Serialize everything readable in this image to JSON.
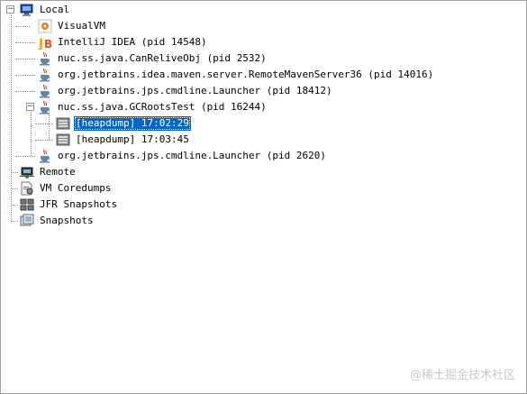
{
  "tree": {
    "local": {
      "label": "Local",
      "toggle": "−"
    },
    "visualvm": {
      "label": "VisualVM"
    },
    "intellij": {
      "label": "IntelliJ IDEA (pid 14548)"
    },
    "canrelive": {
      "label": "nuc.ss.java.CanReliveObj (pid 2532)"
    },
    "maven": {
      "label": "org.jetbrains.idea.maven.server.RemoteMavenServer36 (pid 14016)"
    },
    "launcher1": {
      "label": "org.jetbrains.jps.cmdline.Launcher (pid 18412)"
    },
    "gcroots": {
      "label": "nuc.ss.java.GCRootsTest (pid 16244)",
      "toggle": "−"
    },
    "heapdump1": {
      "label": "[heapdump] 17:02:29"
    },
    "heapdump2": {
      "label": "[heapdump] 17:03:45"
    },
    "launcher2": {
      "label": "org.jetbrains.jps.cmdline.Launcher (pid 2620)"
    },
    "remote": {
      "label": "Remote"
    },
    "coredumps": {
      "label": "VM Coredumps"
    },
    "jfr": {
      "label": "JFR Snapshots"
    },
    "snapshots": {
      "label": "Snapshots"
    }
  },
  "watermark": "@稀土掘金技术社区",
  "colors": {
    "selection": "#0066cc",
    "border": "#a0a0a0"
  }
}
